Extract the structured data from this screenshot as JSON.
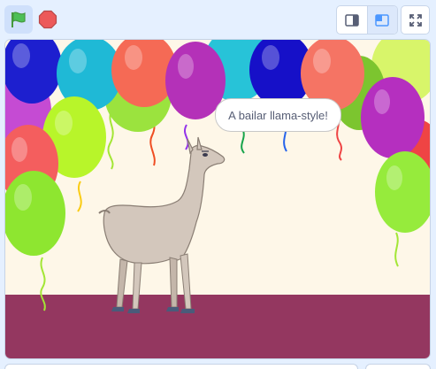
{
  "toolbar": {
    "green_flag_icon": "green-flag-icon",
    "stop_icon": "stop-sign-icon",
    "small_stage_icon": "small-stage-icon",
    "normal_stage_icon": "normal-stage-icon",
    "fullscreen_icon": "fullscreen-icon",
    "active_mode": "normal",
    "flag_color": "#4cbf56",
    "stop_color": "#ec5959",
    "accent_color": "#4c97ff"
  },
  "stage": {
    "backdrop": "party",
    "sprite": "llama",
    "speech_bubble": "A bailar llama-style!",
    "floor_color": "#943760",
    "wall_color": "#fef7e8"
  }
}
